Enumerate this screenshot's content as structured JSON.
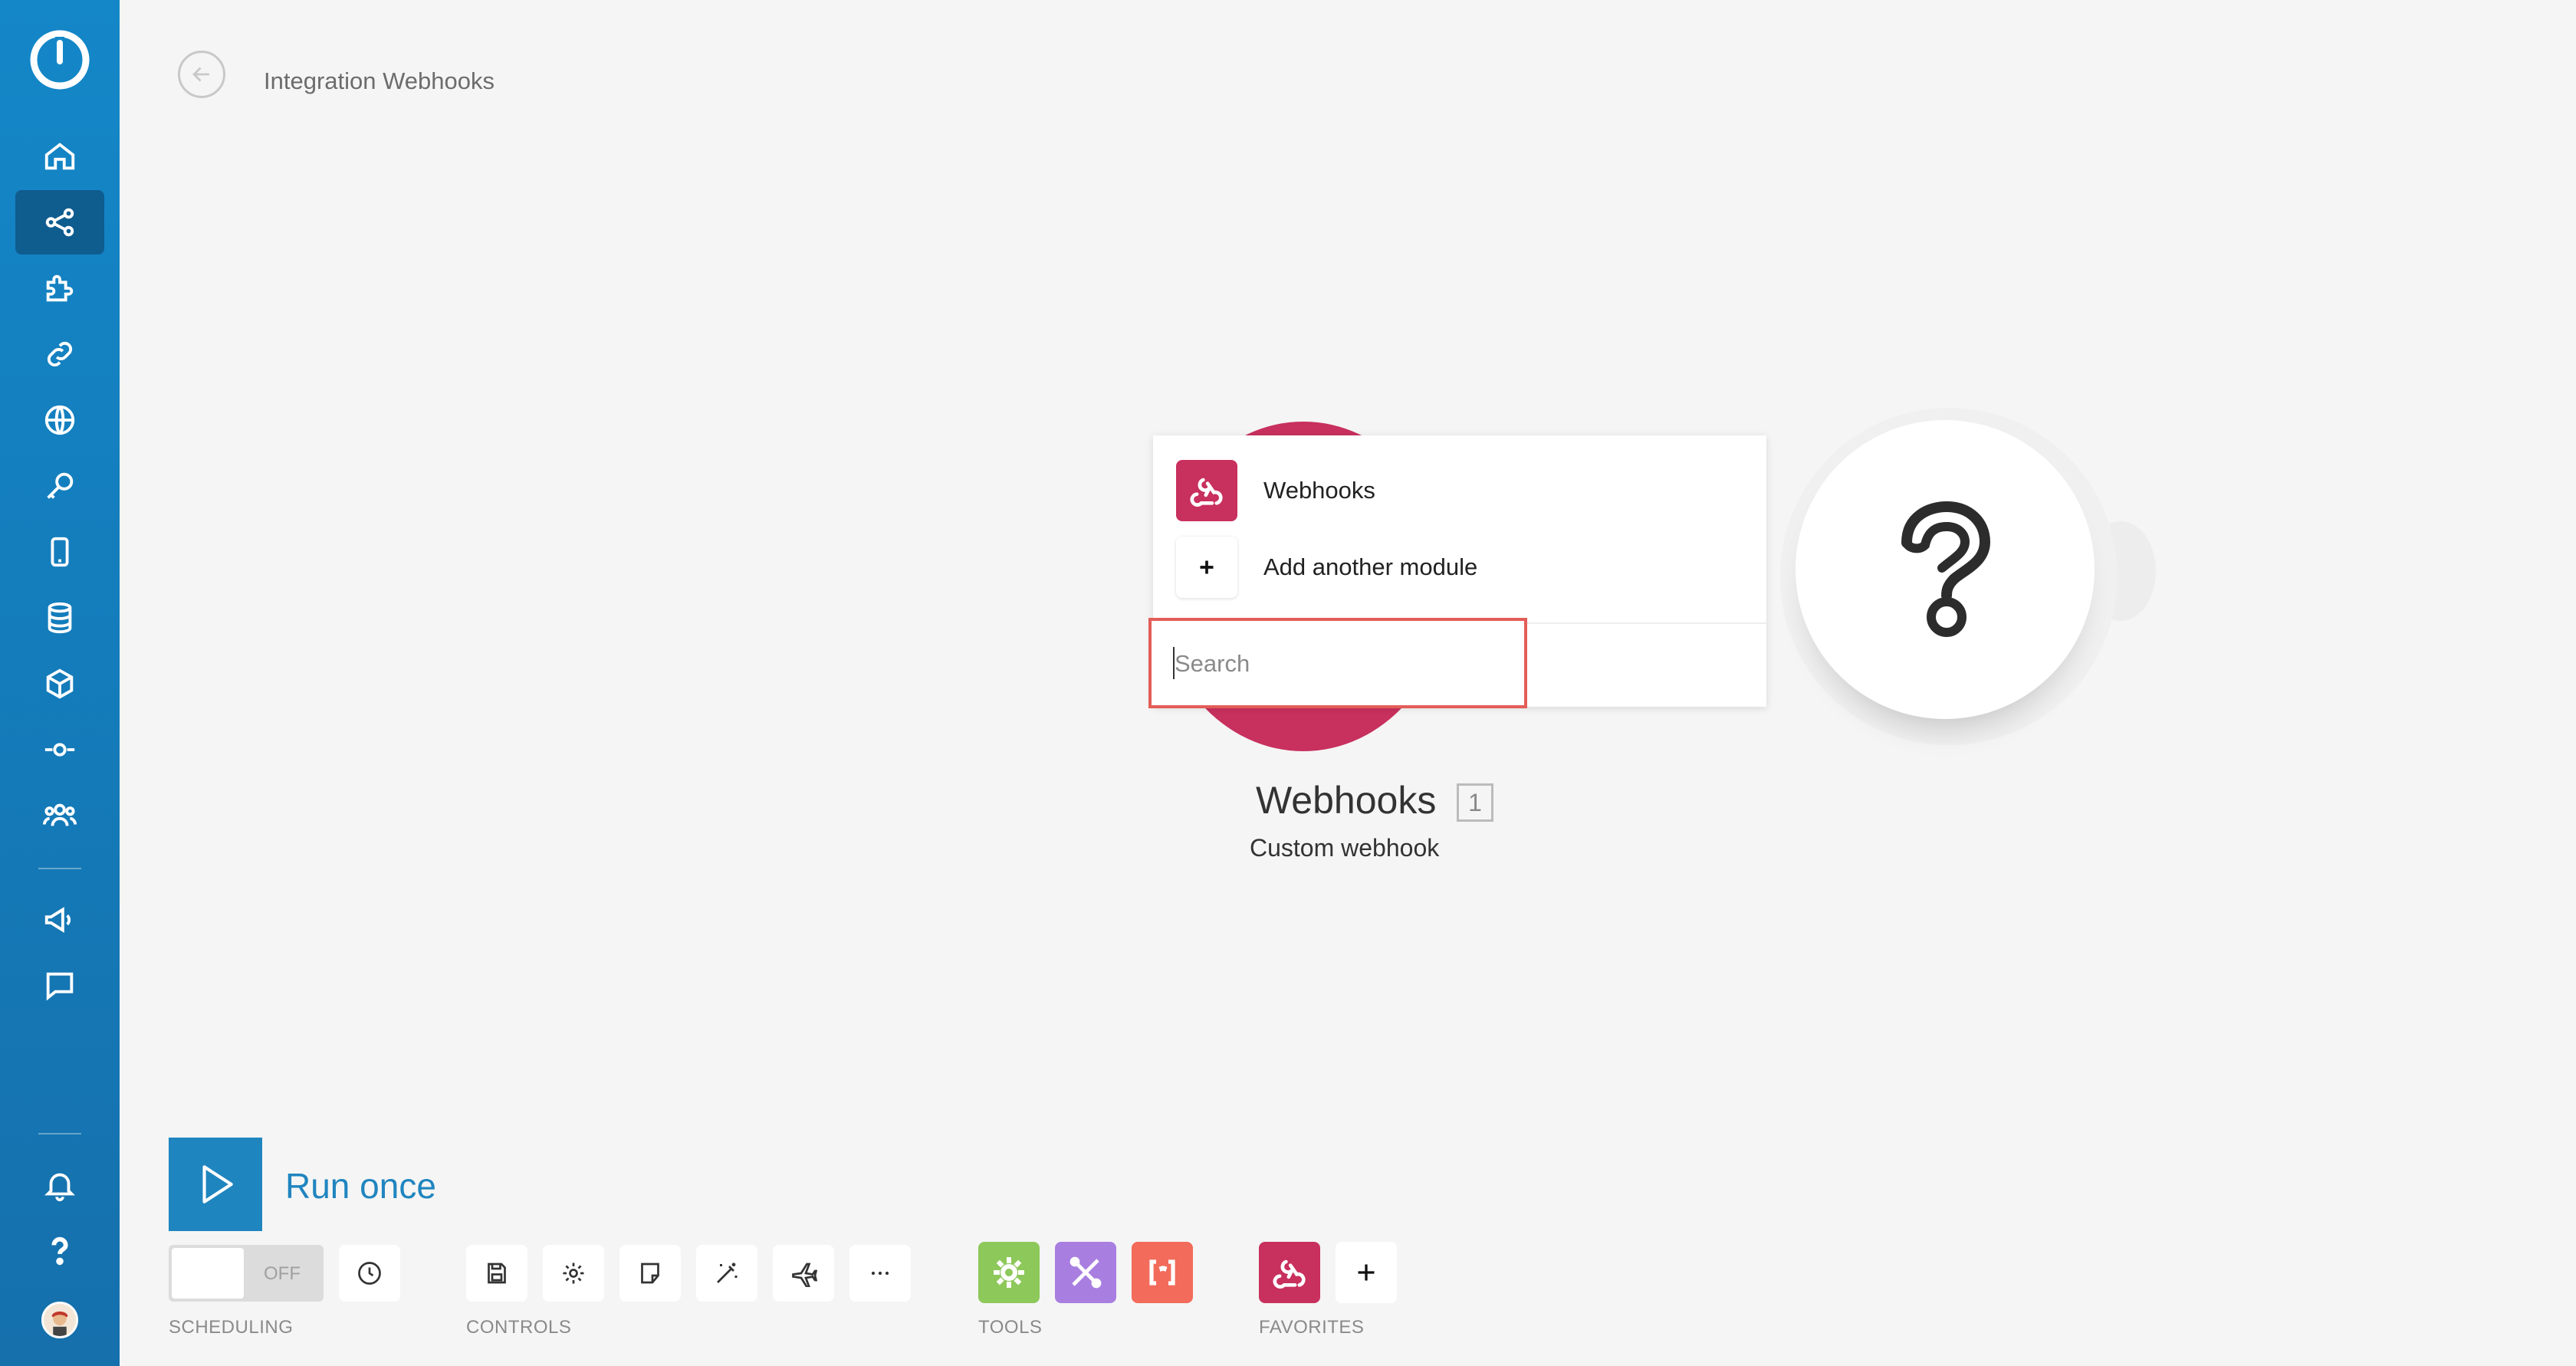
{
  "header": {
    "title": "Integration Webhooks"
  },
  "canvas": {
    "module": {
      "name": "Webhooks",
      "count": "1",
      "subtitle": "Custom webhook"
    },
    "popup": {
      "items": [
        {
          "label": "Webhooks",
          "icon": "webhook-icon"
        },
        {
          "label": "Add another module",
          "icon": "plus-icon"
        }
      ],
      "search_placeholder": "Search",
      "search_value": ""
    }
  },
  "toolbar": {
    "run_label": "Run once",
    "scheduling_toggle": "OFF",
    "sections": {
      "scheduling": "SCHEDULING",
      "controls": "CONTROLS",
      "tools": "TOOLS",
      "favorites": "FAVORITES"
    }
  },
  "colors": {
    "sidebar": "#1487c8",
    "sidebar_active": "#0f5c8f",
    "webhook": "#c8305e",
    "accent": "#1f85bf",
    "search_border": "#e35d57",
    "tools_green": "#8dc85a",
    "tools_purple": "#a87ee0",
    "tools_orange": "#f26b5b"
  }
}
